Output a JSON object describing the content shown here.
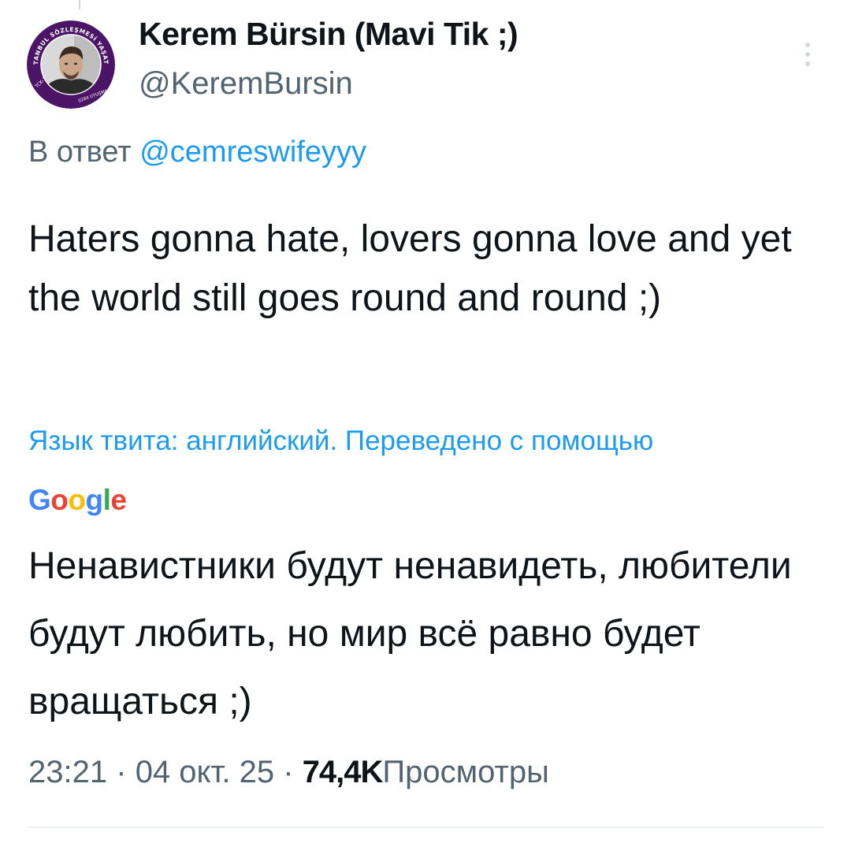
{
  "author": {
    "display_name": "Kerem Bürsin (Mavi Tik ;)",
    "handle": "@KeremBursin",
    "avatar_ring_text": "İSTANBUL SÖZLEŞMESİ YAŞATIR",
    "avatar_bottom_left": "TCK-103",
    "avatar_bottom_right": "0284 UYUŞMA"
  },
  "reply": {
    "prefix": "В ответ",
    "mention": "@cemreswifeyyy"
  },
  "tweet": {
    "text": "Haters gonna hate, lovers gonna love and yet the world still goes round and round ;)"
  },
  "translation": {
    "note": "Язык твита: английский. Переведено с помощью",
    "provider": "Google",
    "text": "Ненавистники будут ненавидеть, любители будут любить, но мир всё равно будет вращаться ;)"
  },
  "meta": {
    "time": "23:21",
    "separator": "·",
    "date": "04 окт. 25",
    "views_count": "74,4K",
    "views_label": "Просмотры"
  },
  "colors": {
    "accent": "#1d9bf0",
    "secondary_text": "#536471",
    "avatar_ring": "#4b1466",
    "google_blue": "#4285F4",
    "google_red": "#EA4335",
    "google_yellow": "#FBBC05",
    "google_green": "#34A853"
  },
  "icons": {
    "more": "more-vertical-icon"
  }
}
